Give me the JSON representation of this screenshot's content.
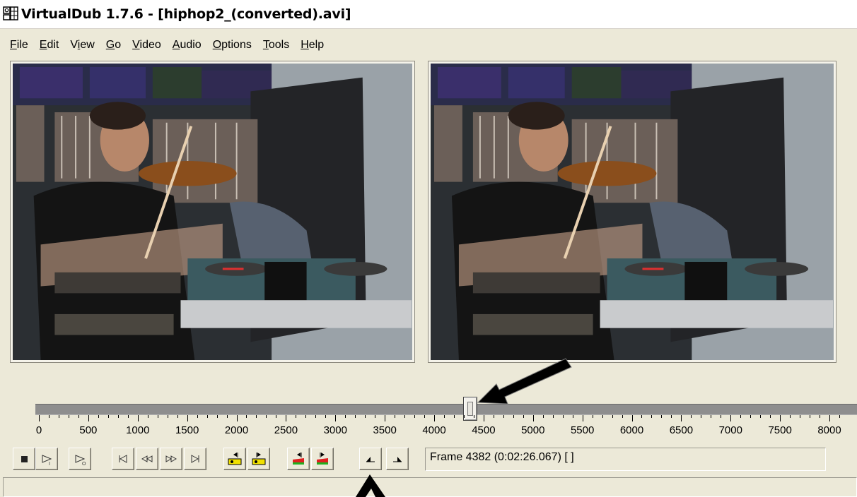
{
  "window": {
    "title": "VirtualDub 1.7.6 - [hiphop2_(converted).avi]",
    "icon": "virtualdub-app-icon"
  },
  "menu": [
    {
      "label": "File",
      "mnemonic": "F",
      "rest": "ile"
    },
    {
      "label": "Edit",
      "mnemonic": "E",
      "rest": "dit"
    },
    {
      "label": "View",
      "pre": "V",
      "mnemonic": "i",
      "rest": "ew"
    },
    {
      "label": "Go",
      "mnemonic": "G",
      "rest": "o"
    },
    {
      "label": "Video",
      "mnemonic": "V",
      "rest": "ideo"
    },
    {
      "label": "Audio",
      "mnemonic": "A",
      "rest": "udio"
    },
    {
      "label": "Options",
      "mnemonic": "O",
      "rest": "ptions"
    },
    {
      "label": "Tools",
      "mnemonic": "T",
      "rest": "ools"
    },
    {
      "label": "Help",
      "mnemonic": "H",
      "rest": "elp"
    }
  ],
  "panes": {
    "input": {
      "content": "video frame: boy playing violin in front of record shelves"
    },
    "output": {
      "content": "video frame: boy playing violin in front of record shelves"
    }
  },
  "timeline": {
    "max_frame": 8200,
    "current_frame": 4382,
    "tick_labels": [
      "0",
      "500",
      "1000",
      "1500",
      "2000",
      "2500",
      "3000",
      "3500",
      "4000",
      "4500",
      "5000",
      "5500",
      "6000",
      "6500",
      "7000",
      "7500",
      "8000"
    ]
  },
  "toolbar": {
    "buttons": [
      {
        "name": "stop-button",
        "icon": "stop-icon"
      },
      {
        "name": "play-input-button",
        "icon": "play-input-icon"
      },
      {
        "name": "play-output-button",
        "icon": "play-output-icon"
      },
      {
        "name": "go-to-start-button",
        "icon": "go-to-start-icon"
      },
      {
        "name": "step-backward-button",
        "icon": "step-backward-icon"
      },
      {
        "name": "step-forward-button",
        "icon": "step-forward-icon"
      },
      {
        "name": "go-to-end-button",
        "icon": "go-to-end-icon"
      },
      {
        "name": "prev-keyframe-button",
        "icon": "prev-keyframe-icon"
      },
      {
        "name": "next-keyframe-button",
        "icon": "next-keyframe-icon"
      },
      {
        "name": "prev-scene-button",
        "icon": "prev-scene-icon"
      },
      {
        "name": "next-scene-button",
        "icon": "next-scene-icon"
      },
      {
        "name": "mark-in-button",
        "icon": "mark-in-icon"
      },
      {
        "name": "mark-out-button",
        "icon": "mark-out-icon"
      }
    ]
  },
  "status": {
    "frame_text": "Frame 4382 (0:02:26.067) [ ]"
  },
  "colors": {
    "window_bg": "#ece9d8",
    "annotation_arrow": "#000000",
    "keyframe_yellow": "#f0e000",
    "scene_red": "#e02020",
    "scene_green": "#20b020"
  }
}
